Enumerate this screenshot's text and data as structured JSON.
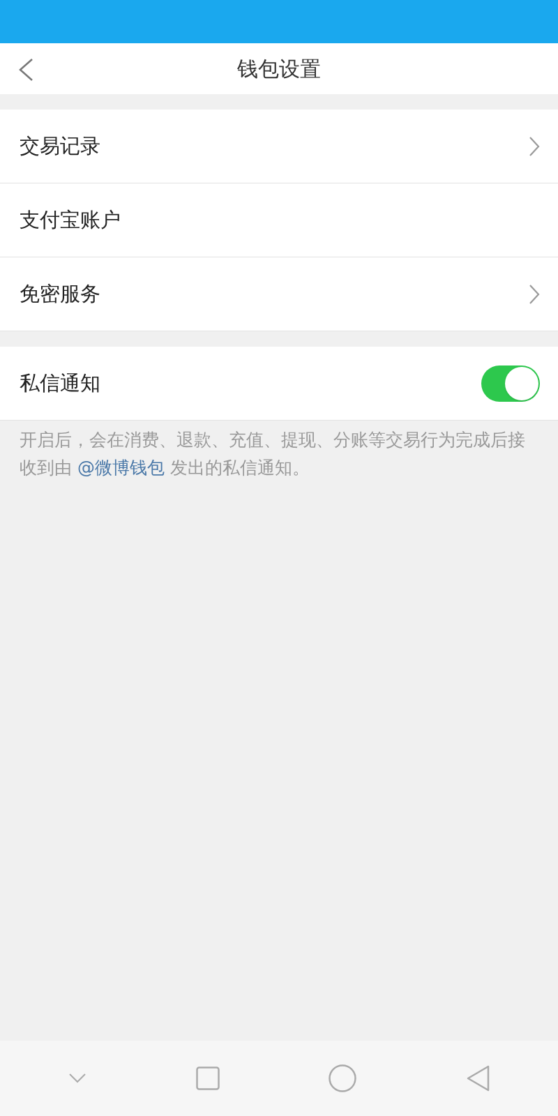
{
  "header": {
    "title": "钱包设置"
  },
  "groups": [
    [
      {
        "label": "交易记录",
        "kind": "link"
      },
      {
        "label": "支付宝账户",
        "kind": "plain"
      },
      {
        "label": "免密服务",
        "kind": "link"
      }
    ],
    [
      {
        "label": "私信通知",
        "kind": "toggle",
        "on": true
      }
    ]
  ],
  "note": {
    "before": "开启后，会在消费、退款、充值、提现、分账等交易行为完成后接收到由 ",
    "link": "@微博钱包",
    "after": " 发出的私信通知。"
  }
}
